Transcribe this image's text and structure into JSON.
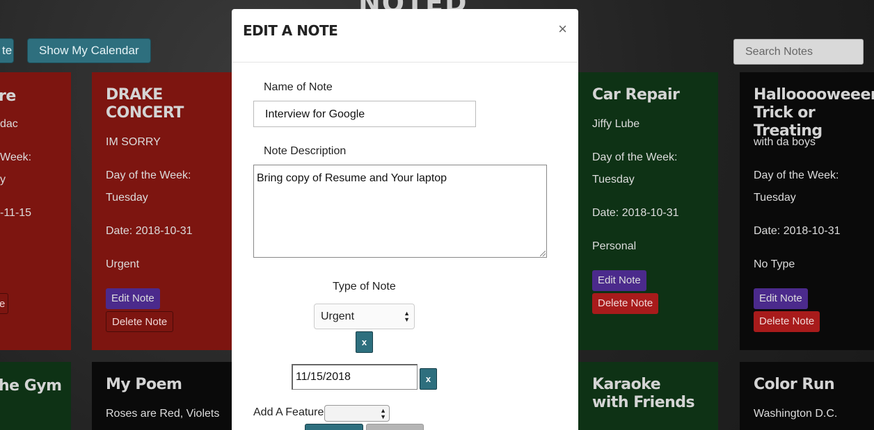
{
  "app": {
    "title": "NOTED"
  },
  "toolbar": {
    "add_note_label": "te",
    "calendar_label": "Show My Calendar",
    "search_placeholder": "Search Notes"
  },
  "cards": [
    {
      "title": "re",
      "desc": "dac",
      "dow_label": "Week:",
      "dow": "y",
      "date": "-11-15",
      "type": "",
      "edit_label": "",
      "delete_label": "e",
      "color": "#7d1510"
    },
    {
      "title": "DRAKE CONCERT",
      "desc": "IM SORRY",
      "dow_label": "Day of the Week:",
      "dow": "Tuesday",
      "date": "Date: 2018-10-31",
      "type": "Urgent",
      "edit_label": "Edit Note",
      "delete_label": "Delete Note",
      "color": "#7d1510"
    },
    {
      "title": "Car Repair",
      "desc": "Jiffy Lube",
      "dow_label": "Day of the Week:",
      "dow": "Tuesday",
      "date": "Date: 2018-10-31",
      "type": "Personal",
      "edit_label": "Edit Note",
      "delete_label": "Delete Note",
      "color": "#0e3215"
    },
    {
      "title": "Hallooooweeen Trick or Treating",
      "desc": "with da boys",
      "dow_label": "Day of the Week:",
      "dow": "Tuesday",
      "date": "Date: 2018-10-31",
      "type": "No Type",
      "edit_label": "Edit Note",
      "delete_label": "Delete Note",
      "color": "#0a0a0a"
    },
    {
      "title": "he Gym",
      "desc": "",
      "color": "#0e3215"
    },
    {
      "title": "My Poem",
      "desc": "Roses are Red, Violets",
      "color": "#0a0a0a"
    },
    {
      "title": "Karaoke with Friends",
      "desc": "",
      "color": "#0e3215"
    },
    {
      "title": "Color Run",
      "desc": "Washington D.C.",
      "color": "#0a0a0a"
    }
  ],
  "modal": {
    "title": "EDIT A NOTE",
    "close_label": "×",
    "name_label": "Name of Note",
    "name_value": "Interview for Google",
    "desc_label": "Note Description",
    "desc_value": "Bring copy of Resume and Your laptop",
    "type_label": "Type of Note",
    "type_value": "Urgent",
    "clear_type_label": "x",
    "date_value": "11/15/2018",
    "clear_date_label": "x",
    "feature_label": "Add A Feature",
    "feature_value": ""
  },
  "colors": {
    "accent_teal": "#2e6f7e",
    "urgent_red": "#7d1510",
    "personal_green": "#0e3215",
    "edit_purple": "#4b2a8c",
    "delete_red": "#a81b1b"
  }
}
